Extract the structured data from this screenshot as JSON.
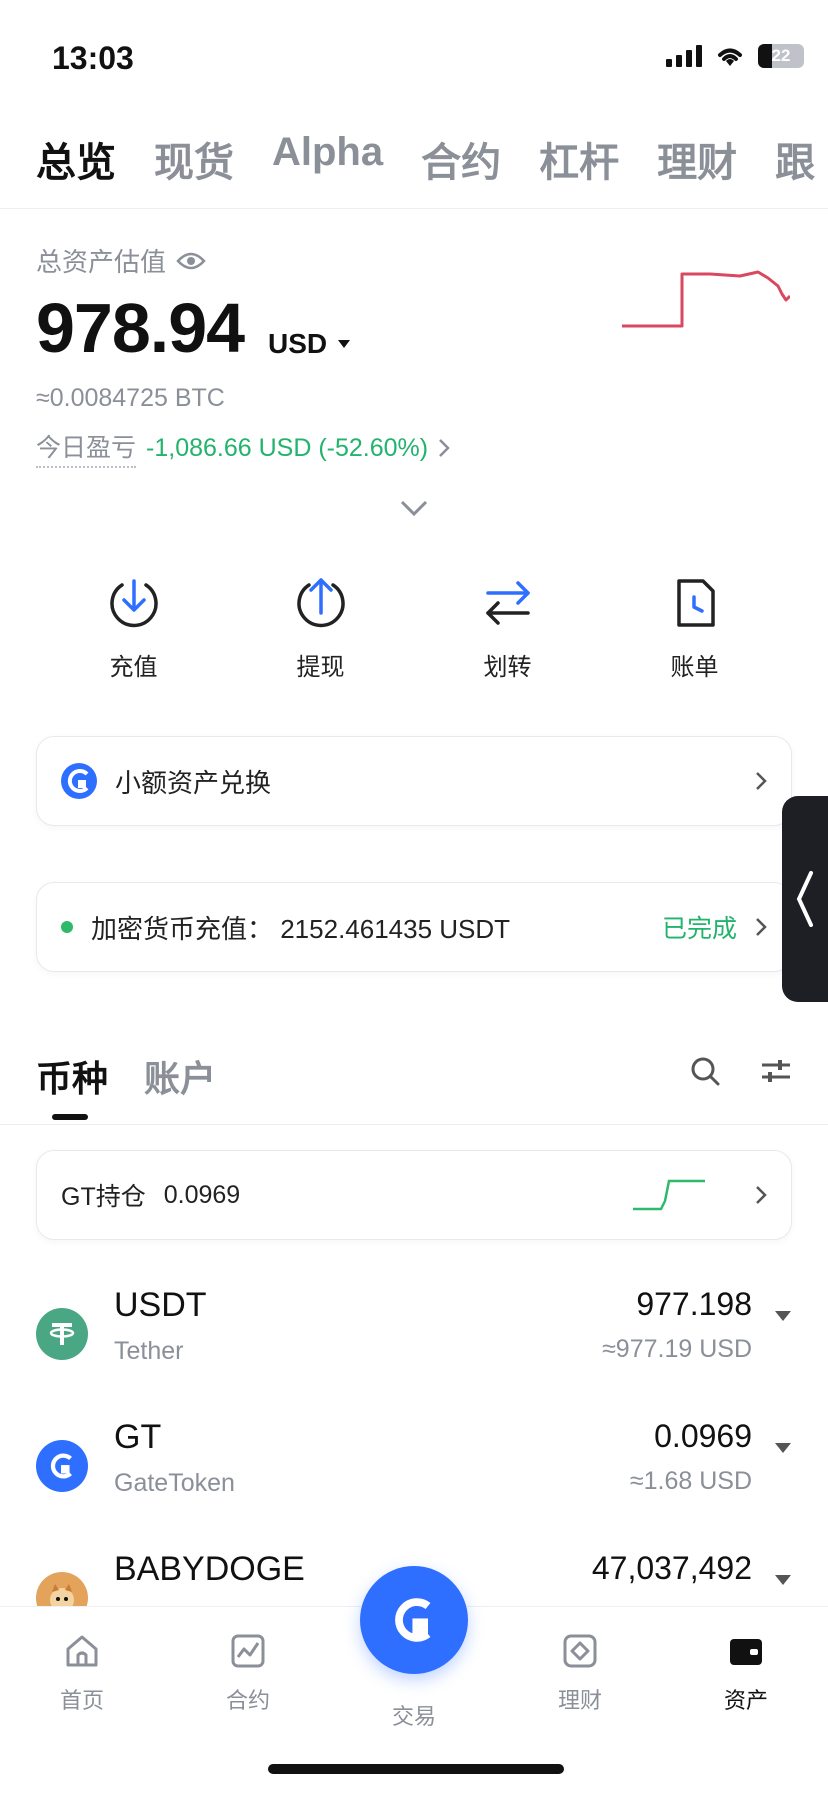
{
  "status": {
    "time": "13:03",
    "battery": "22"
  },
  "top_tabs": [
    "总览",
    "现货",
    "Alpha",
    "合约",
    "杠杆",
    "理财",
    "跟"
  ],
  "asset": {
    "title": "总资产估值",
    "value": "978.94",
    "unit": "USD",
    "btc": "≈0.0084725 BTC",
    "pnl_label": "今日盈亏",
    "pnl_value": "-1,086.66 USD (-52.60%)"
  },
  "quick_actions": [
    {
      "label": "充值",
      "icon": "download-circle-icon"
    },
    {
      "label": "提现",
      "icon": "upload-circle-icon"
    },
    {
      "label": "划转",
      "icon": "transfer-arrows-icon"
    },
    {
      "label": "账单",
      "icon": "bill-clock-icon"
    }
  ],
  "cards": {
    "small_asset": "小额资产兑换",
    "deposit": "加密货币充值：  2152.461435 USDT",
    "deposit_status": "已完成"
  },
  "section_tabs": [
    "币种",
    "账户"
  ],
  "gt_holding": {
    "label": "GT持仓",
    "value": "0.0969"
  },
  "coins": [
    {
      "symbol": "USDT",
      "name": "Tether",
      "amount": "977.198",
      "usd": "≈977.19 USD",
      "color": "#4aa784"
    },
    {
      "symbol": "GT",
      "name": "GateToken",
      "amount": "0.0969",
      "usd": "≈1.68 USD",
      "color": "#2f6fff"
    },
    {
      "symbol": "BABYDOGE",
      "name": "",
      "amount": "47,037,492",
      "usd": "",
      "color": "#e3a35a"
    }
  ],
  "tabbar": [
    "首页",
    "合约",
    "交易",
    "理财",
    "资产"
  ],
  "colors": {
    "accent": "#2f6fff",
    "green": "#22b36c",
    "red": "#d9485f"
  }
}
